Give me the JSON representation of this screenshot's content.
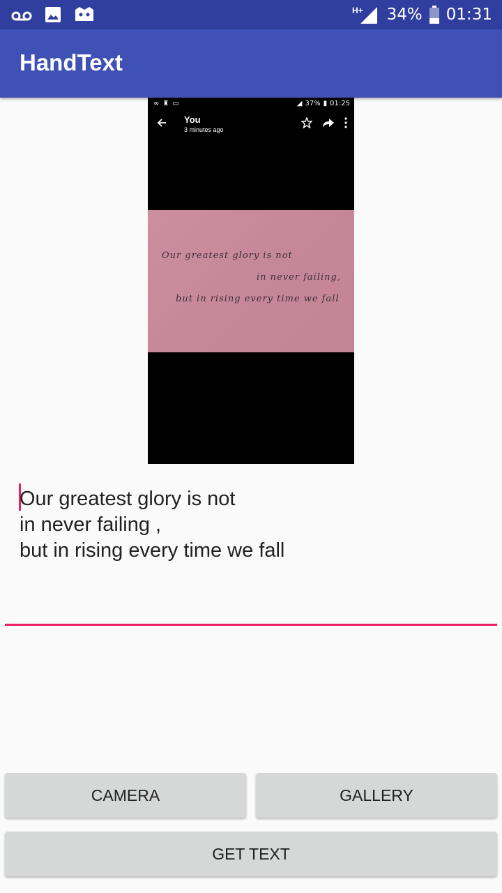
{
  "status_bar": {
    "icons": [
      "voicemail-icon",
      "image-icon",
      "game-icon"
    ],
    "network": "H+",
    "battery": "34%",
    "time": "01:31"
  },
  "app_bar": {
    "title": "HandText"
  },
  "preview": {
    "status": {
      "battery": "37%",
      "time": "01:25"
    },
    "toolbar": {
      "name": "You",
      "subtitle": "3 minutes ago"
    },
    "handwriting": [
      "Our greatest glory is not",
      "in never failing,",
      "but in rising every time we fall"
    ]
  },
  "text_field": {
    "lines": [
      "Our greatest glory is not",
      "in never failing ,",
      "but in rising every time we fall"
    ]
  },
  "buttons": {
    "camera": "CAMERA",
    "gallery": "GALLERY",
    "get_text": "GET TEXT"
  },
  "colors": {
    "status_bar": "#303f9f",
    "app_bar": "#3f51b5",
    "accent": "#e91e63",
    "button": "#d6d7d7"
  }
}
